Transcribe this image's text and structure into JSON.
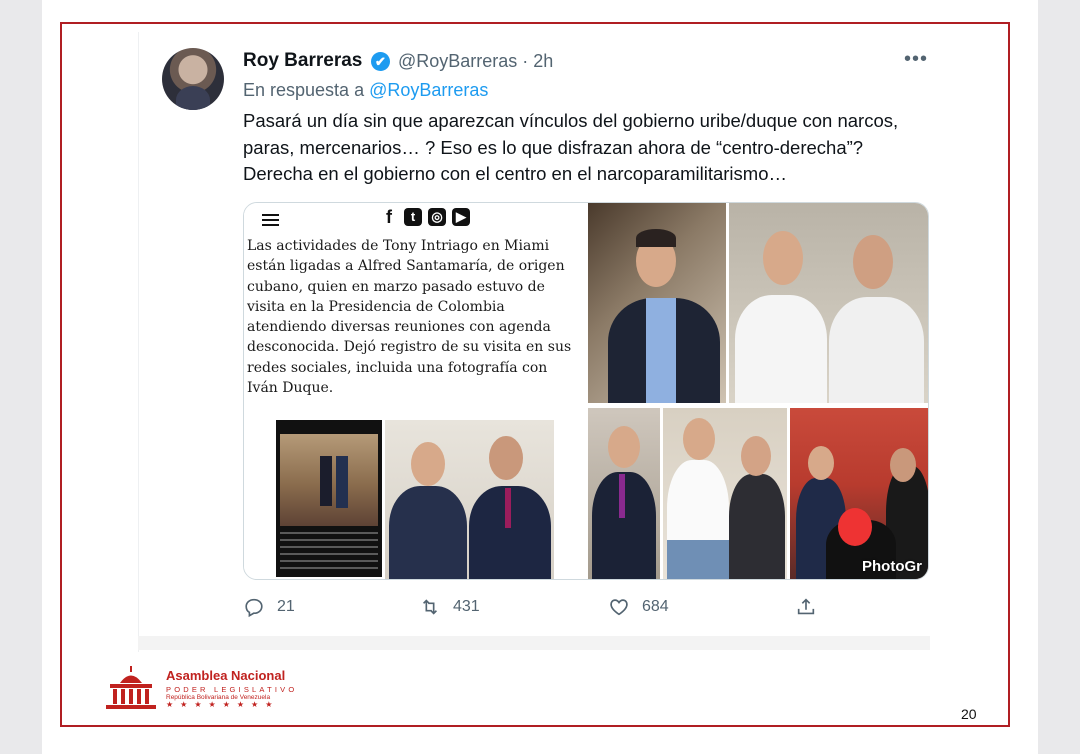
{
  "tweet": {
    "author_name": "Roy Barreras",
    "handle_time": "@RoyBarreras · 2h",
    "reply_prefix": "En respuesta a",
    "reply_to": "@RoyBarreras",
    "text": "Pasará un día sin que aparezcan vínculos del gobierno uribe/duque con narcos, paras, mercenarios… ? Eso es lo que disfrazan ahora de “centro-derecha”? Derecha en el gobierno con el centro en el narcoparamilitarismo…",
    "more": "•••",
    "verified_icon": "✔",
    "media": {
      "article_text": "Las actividades de Tony Intriago en Miami están ligadas a Alfred Santamaría, de origen cubano, quien en marzo pasado estuvo de visita en la Presidencia de Colombia atendiendo diversas reuniones con agenda desconocida. Dejó registro de su visita en sus redes sociales, incluida una fotografía con Iván Duque.",
      "social_icons": [
        "facebook-icon",
        "twitter-icon",
        "instagram-icon",
        "youtube-icon"
      ],
      "watermark": "PhotoGr"
    },
    "actions": {
      "replies": "21",
      "retweets": "431",
      "likes": "684"
    }
  },
  "footer": {
    "org_name": "Asamblea Nacional",
    "org_sub": "PODER LEGISLATIVO",
    "org_country": "República Bolivariana de Venezuela",
    "stars": "★★★★★★★★",
    "page_number": "20"
  },
  "colors": {
    "frame": "#b01e23",
    "link": "#1d9bf0",
    "org": "#c0221f"
  }
}
